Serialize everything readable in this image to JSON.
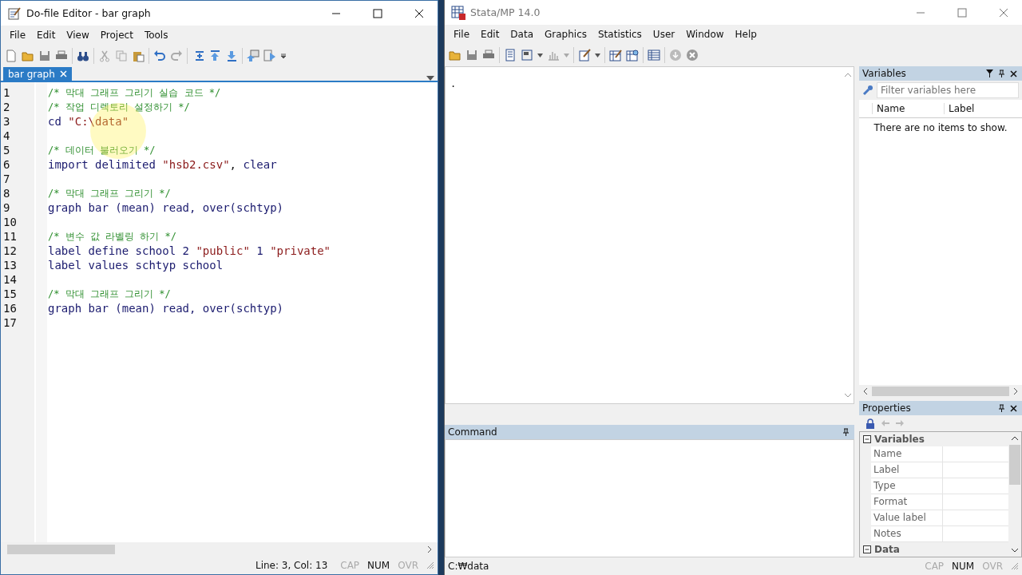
{
  "editor_window": {
    "title": "Do-file Editor - bar graph",
    "menu": [
      "File",
      "Edit",
      "View",
      "Project",
      "Tools"
    ],
    "tabs": [
      {
        "label": "bar graph",
        "selected": true
      }
    ],
    "lines": [
      {
        "number": "1",
        "tokens": [
          {
            "kind": "comment",
            "text": "/* 막대 그래프 그리기 실습 코드 */"
          }
        ]
      },
      {
        "number": "2",
        "tokens": [
          {
            "kind": "comment",
            "text": "/* 작업 디렉토리 설정하기 */"
          }
        ]
      },
      {
        "number": "3",
        "tokens": [
          {
            "kind": "keyword",
            "text": "cd "
          },
          {
            "kind": "string",
            "text": "\"C:\\data\""
          }
        ]
      },
      {
        "number": "4"
      },
      {
        "number": "5",
        "tokens": [
          {
            "kind": "comment",
            "text": "/* 데이터 불러오기 */"
          }
        ]
      },
      {
        "number": "6",
        "tokens": [
          {
            "kind": "keyword",
            "text": "import delimited "
          },
          {
            "kind": "string",
            "text": "\"hsb2.csv\""
          },
          {
            "kind": "plain",
            "text": ", "
          },
          {
            "kind": "keyword",
            "text": "clear"
          }
        ]
      },
      {
        "number": "7"
      },
      {
        "number": "8",
        "tokens": [
          {
            "kind": "comment",
            "text": "/* 막대 그래프 그리기 */"
          }
        ]
      },
      {
        "number": "9",
        "tokens": [
          {
            "kind": "keyword",
            "text": "graph bar (mean) read, over(schtyp)"
          }
        ]
      },
      {
        "number": "10"
      },
      {
        "number": "11",
        "tokens": [
          {
            "kind": "comment",
            "text": "/* 변수 값 라벨링 하기 */"
          }
        ]
      },
      {
        "number": "12",
        "tokens": [
          {
            "kind": "keyword",
            "text": "label define school 2 "
          },
          {
            "kind": "string",
            "text": "\"public\""
          },
          {
            "kind": "keyword",
            "text": " 1 "
          },
          {
            "kind": "string",
            "text": "\"private\""
          }
        ]
      },
      {
        "number": "13",
        "tokens": [
          {
            "kind": "keyword",
            "text": "label values schtyp school"
          }
        ]
      },
      {
        "number": "14"
      },
      {
        "number": "15",
        "tokens": [
          {
            "kind": "comment",
            "text": "/* 막대 그래프 그리기 */"
          }
        ]
      },
      {
        "number": "16",
        "tokens": [
          {
            "kind": "keyword",
            "text": "graph bar (mean) read, over(schtyp)"
          }
        ]
      },
      {
        "number": "17"
      }
    ],
    "status": {
      "position": "Line: 3, Col: 13",
      "indicators": [
        {
          "label": "CAP",
          "on": false
        },
        {
          "label": "NUM",
          "on": true
        },
        {
          "label": "OVR",
          "on": false
        }
      ]
    }
  },
  "stata_window": {
    "title": "Stata/MP 14.0",
    "menu": [
      "File",
      "Edit",
      "Data",
      "Graphics",
      "Statistics",
      "User",
      "Window",
      "Help"
    ],
    "results": ".",
    "variables_panel": {
      "title": "Variables",
      "filter_placeholder": "Filter variables here",
      "columns": [
        "Name",
        "Label"
      ],
      "empty_message": "There are no items to show."
    },
    "command_panel": {
      "title": "Command"
    },
    "properties_panel": {
      "title": "Properties",
      "sections": [
        {
          "label": "Variables",
          "expanded": true,
          "rows": [
            "Name",
            "Label",
            "Type",
            "Format",
            "Value label",
            "Notes"
          ]
        },
        {
          "label": "Data",
          "expanded": true
        }
      ]
    },
    "status": {
      "path": "C:₩data",
      "indicators": [
        {
          "label": "CAP",
          "on": false
        },
        {
          "label": "NUM",
          "on": true
        },
        {
          "label": "OVR",
          "on": false
        }
      ]
    }
  }
}
